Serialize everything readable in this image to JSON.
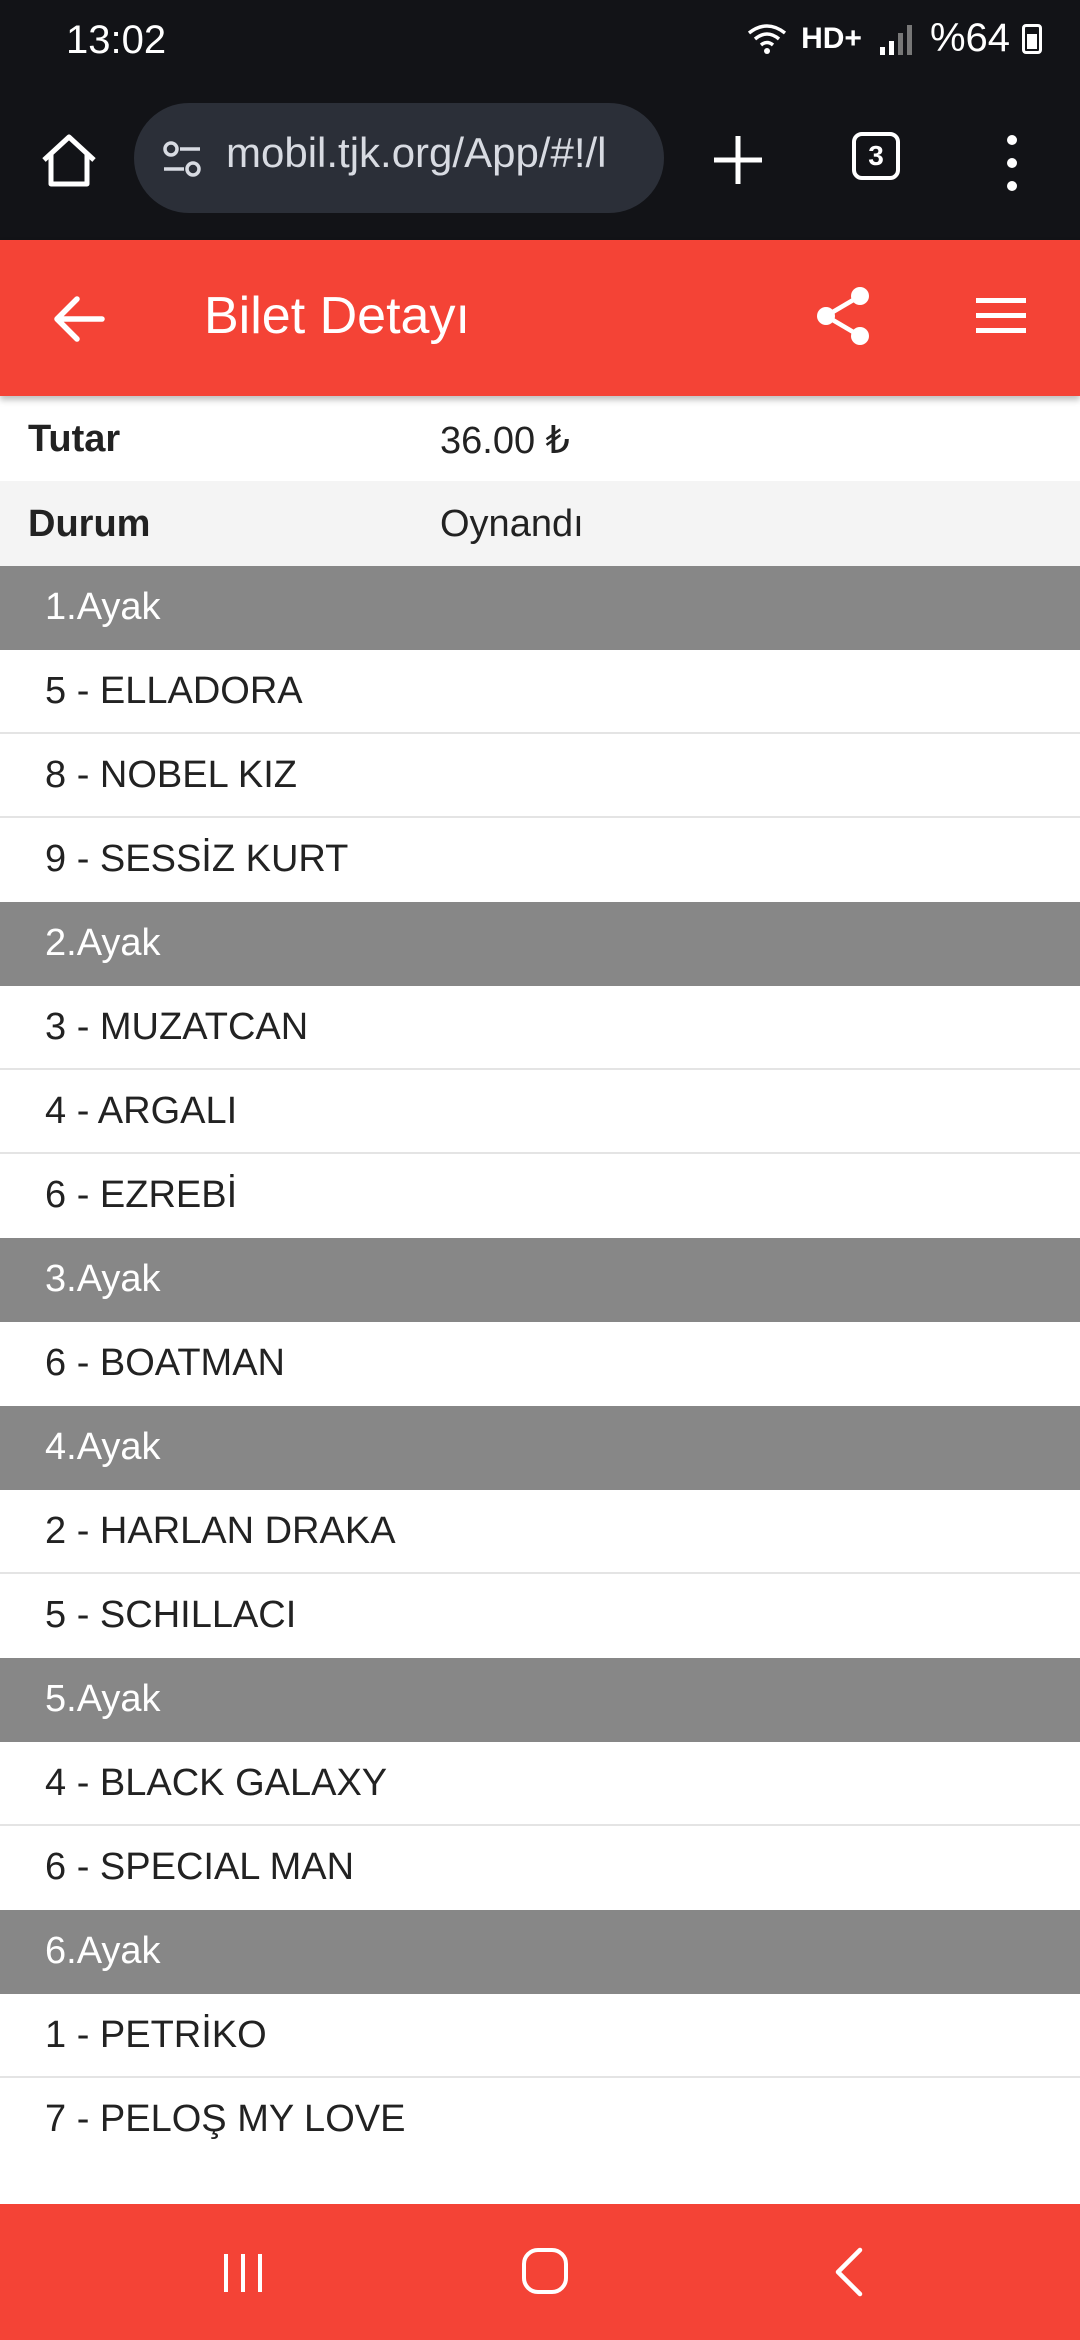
{
  "status_bar": {
    "time": "13:02",
    "network": "HD+",
    "battery": "%64",
    "icons": [
      "wifi-icon",
      "signal-icon",
      "battery-icon"
    ]
  },
  "browser": {
    "url": "mobil.tjk.org/App/#!/l",
    "tab_count": "3",
    "icons": [
      "home-icon",
      "site-settings-icon",
      "new-tab-plus-icon",
      "tab-switcher-icon",
      "overflow-menu-icon"
    ]
  },
  "app_header": {
    "title": "Bilet Detayı",
    "icons": [
      "back-arrow-icon",
      "share-icon",
      "hamburger-menu-icon"
    ],
    "color": "#f44336"
  },
  "ticket": {
    "amount_label": "Tutar",
    "amount_value": "36.00 ₺",
    "status_label": "Durum",
    "status_value": "Oynandı"
  },
  "legs": [
    {
      "title": "1.Ayak",
      "horses": [
        "5 - ELLADORA",
        "8 - NOBEL KIZ",
        "9 - SESSİZ KURT"
      ]
    },
    {
      "title": "2.Ayak",
      "horses": [
        "3 - MUZATCAN",
        "4 - ARGALI",
        "6 - EZREBİ"
      ]
    },
    {
      "title": "3.Ayak",
      "horses": [
        "6 - BOATMAN"
      ]
    },
    {
      "title": "4.Ayak",
      "horses": [
        "2 - HARLAN DRAKA",
        "5 - SCHILLACI"
      ]
    },
    {
      "title": "5.Ayak",
      "horses": [
        "4 - BLACK GALAXY",
        "6 - SPECIAL MAN"
      ]
    },
    {
      "title": "6.Ayak",
      "horses": [
        "1 - PETRİKO",
        "7 - PELOŞ MY LOVE"
      ]
    }
  ],
  "nav_bar": {
    "icons": [
      "recent-apps-icon",
      "home-nav-icon",
      "back-nav-icon"
    ]
  }
}
